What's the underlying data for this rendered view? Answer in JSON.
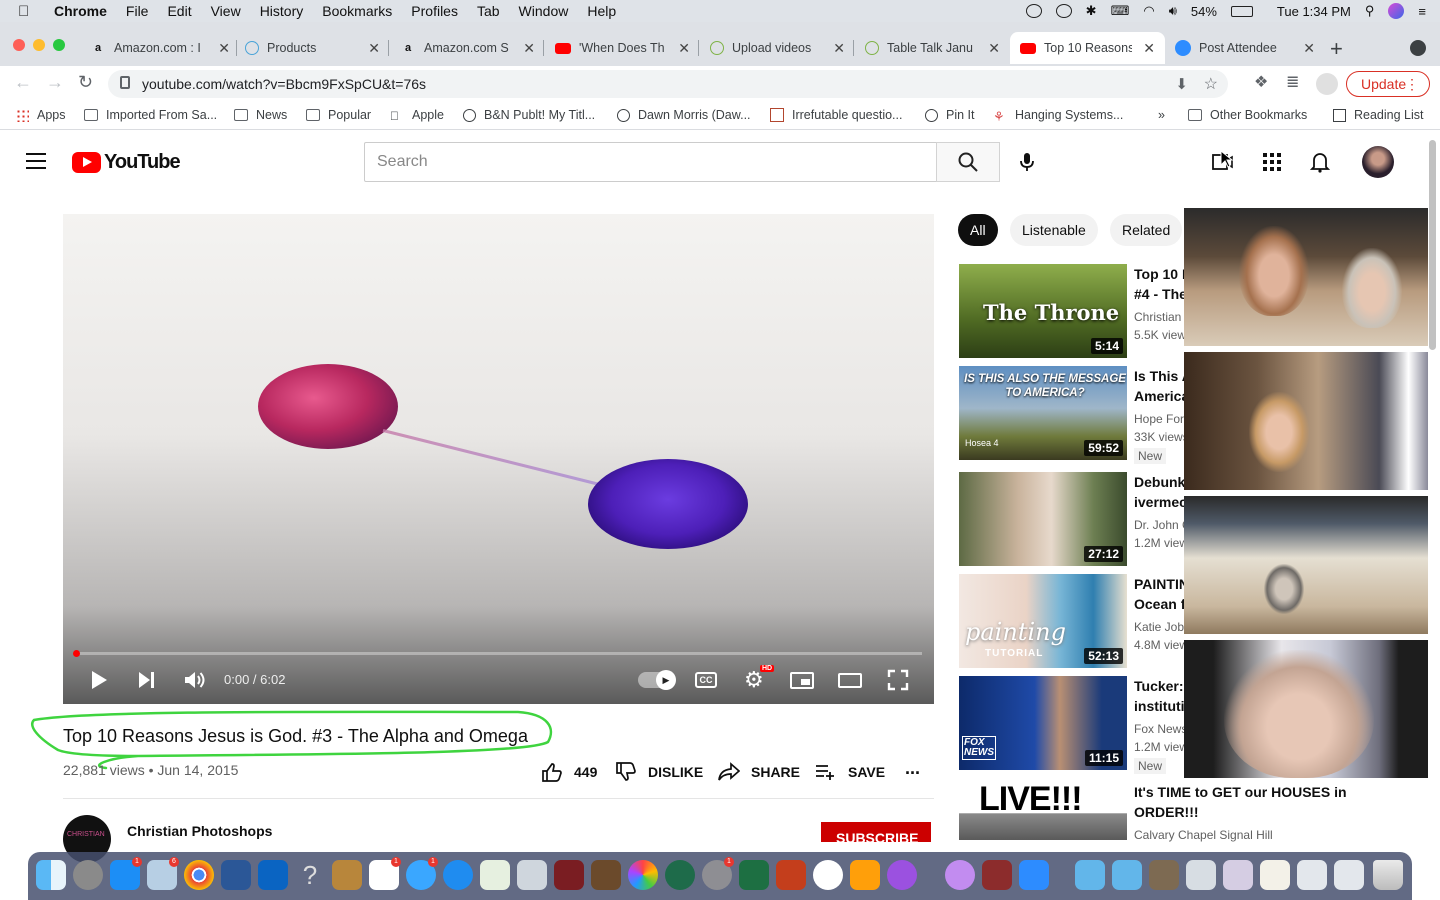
{
  "menubar": {
    "app": "Chrome",
    "items": [
      "File",
      "Edit",
      "View",
      "History",
      "Bookmarks",
      "Profiles",
      "Tab",
      "Window",
      "Help"
    ],
    "battery": "54%",
    "clock": "Tue 1:34 PM"
  },
  "tabs": [
    {
      "title": "Amazon.com : I",
      "icon": "amazon-icon"
    },
    {
      "title": "Products",
      "icon": "products-icon"
    },
    {
      "title": "Amazon.com S",
      "icon": "amazon-icon"
    },
    {
      "title": "'When Does Th",
      "icon": "youtube-icon"
    },
    {
      "title": "Upload videos",
      "icon": "vimeo-icon"
    },
    {
      "title": "Table Talk Janu",
      "icon": "vimeo-icon"
    },
    {
      "title": "Top 10 Reasons",
      "icon": "youtube-icon",
      "active": true
    },
    {
      "title": "Post Attendee",
      "icon": "zoom-icon"
    }
  ],
  "addressbar": {
    "url": "youtube.com/watch?v=Bbcm9FxSpCU&t=76s",
    "update_label": "Update"
  },
  "bookmarks": {
    "items": [
      "Apps",
      "Imported From Sa...",
      "News",
      "Popular",
      "Apple",
      "B&N Publt! My Titl...",
      "Dawn Morris (Daw...",
      "Irrefutable questio...",
      "Pin It",
      "Hanging Systems..."
    ],
    "more": "»",
    "other": "Other Bookmarks",
    "reading": "Reading List"
  },
  "youtube": {
    "logo": "YouTube",
    "search_placeholder": "Search"
  },
  "player": {
    "time": "0:00 / 6:02",
    "progress": 0.0,
    "hd_badge": "HD"
  },
  "video": {
    "title": "Top 10 Reasons Jesus is God. #3 - The Alpha and Omega",
    "meta": "22,881 views • Jun 14, 2015",
    "likes": "449",
    "dislike_label": "DISLIKE",
    "share_label": "SHARE",
    "save_label": "SAVE",
    "more": "..."
  },
  "channel": {
    "name": "Christian Photoshops",
    "subscribe": "SUBSCRIBE",
    "avatar_text": "CHRISTIAN"
  },
  "chips": [
    "All",
    "Listenable",
    "Related"
  ],
  "sidebar": [
    {
      "title1": "Top 10 R",
      "title2": "#4 - The",
      "channel": "Christian",
      "views": "5.5K view",
      "duration": "5:14",
      "thumb_text": "The Throne"
    },
    {
      "title1": "Is This A",
      "title2": "America",
      "channel": "Hope For",
      "views": "33K views",
      "duration": "59:52",
      "badge": "New",
      "thumb_text": "IS THIS ALSO THE MESSAGE TO AMERICA?",
      "thumb_sub": "Hosea 4"
    },
    {
      "title1": "Debunki",
      "title2": "ivermec",
      "channel": "Dr. John C",
      "views": "1.2M view",
      "duration": "27:12"
    },
    {
      "title1": "PAINTIN",
      "title2": "Ocean fo",
      "channel": "Katie Job",
      "views": "4.8M view",
      "duration": "52:13",
      "thumb_text": "painting",
      "thumb_sub": "TUTORIAL"
    },
    {
      "title1": "Tucker:",
      "title2": "institutio",
      "channel": "Fox News",
      "views": "1.2M view",
      "duration": "11:15",
      "badge": "New",
      "thumb_text": "FOX NEWS"
    },
    {
      "title1": "It's TIME to GET our HOUSES in",
      "title2": "ORDER!!!",
      "channel": "Calvary Chapel Signal Hill",
      "thumb_text": "LIVE!!!"
    }
  ],
  "colors": {
    "youtube_red": "#ff0000",
    "update_red": "#d93025",
    "subscribe_red": "#cc0000",
    "annotation_green": "#3fd43f"
  }
}
